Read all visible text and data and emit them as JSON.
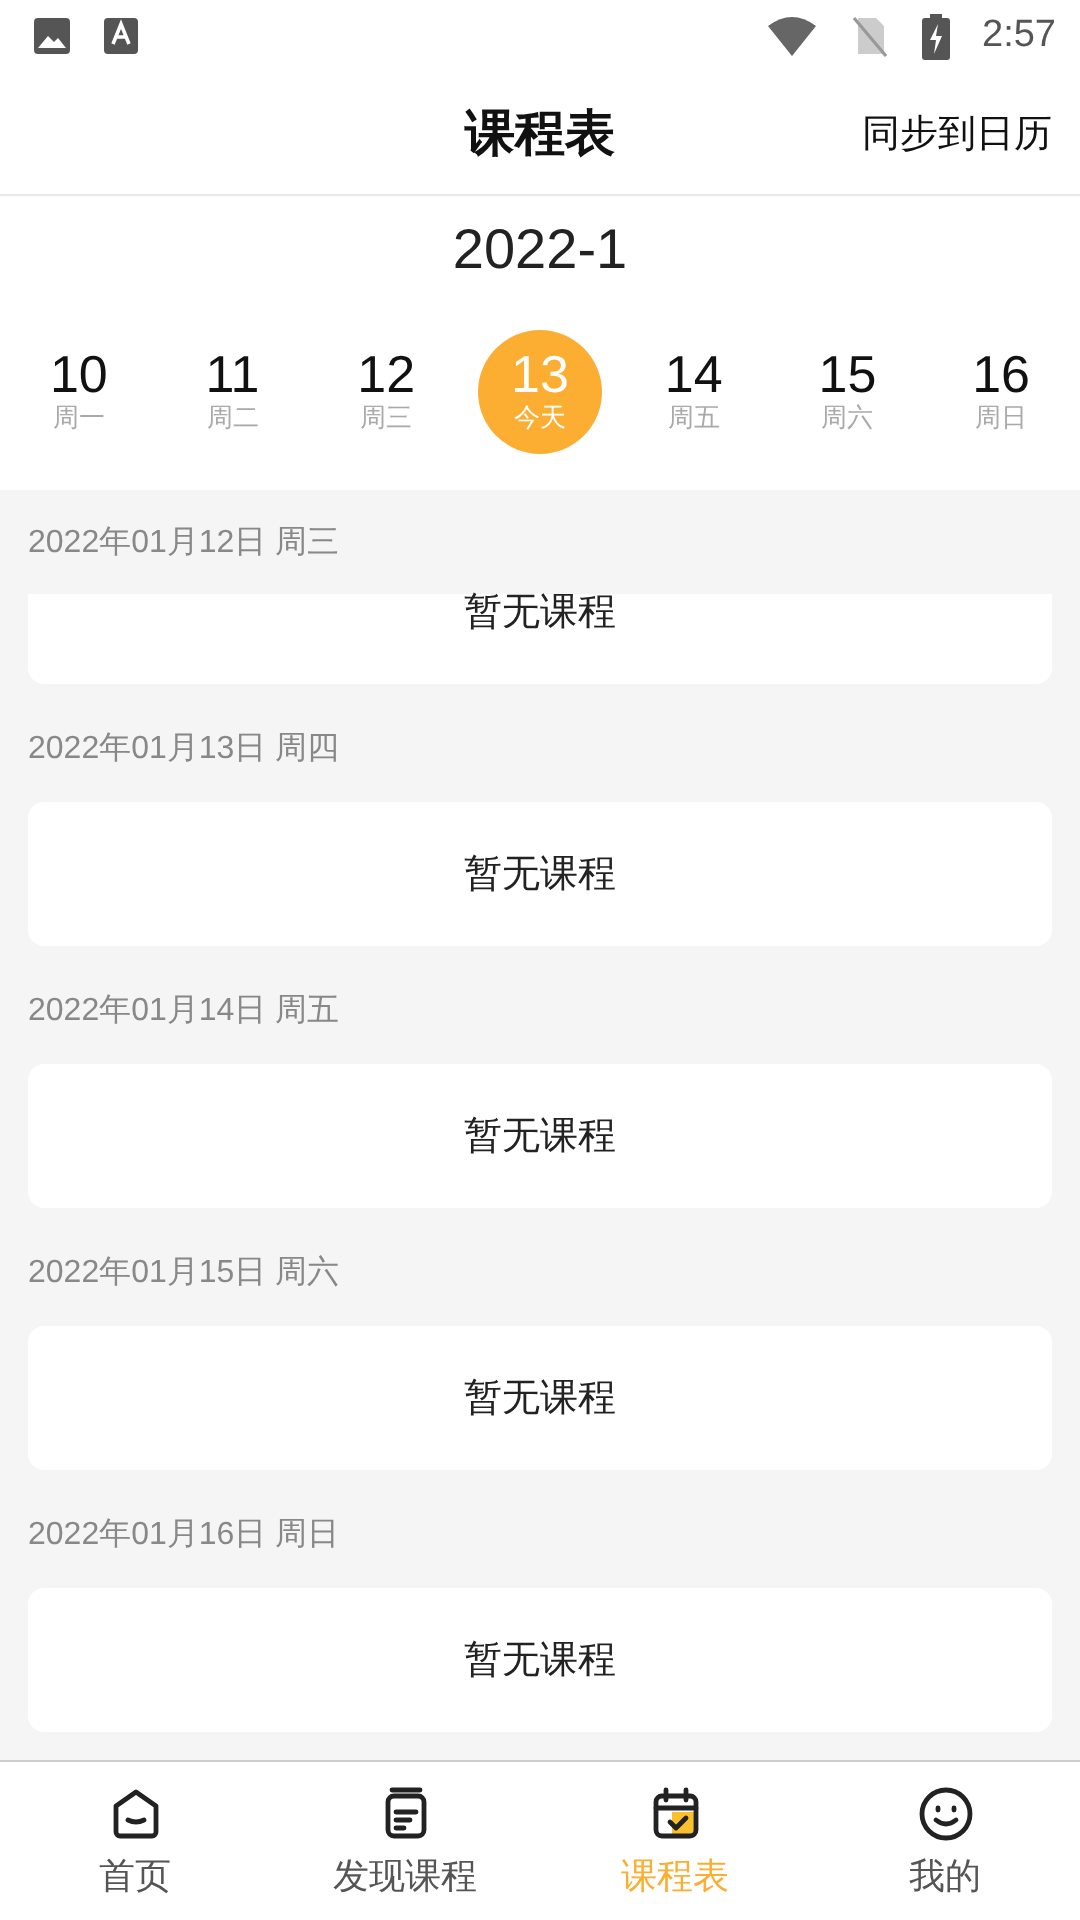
{
  "status_bar": {
    "time": "2:57"
  },
  "header": {
    "title": "课程表",
    "action": "同步到日历"
  },
  "month": "2022-1",
  "week": [
    {
      "day": "10",
      "label": "周一",
      "selected": false
    },
    {
      "day": "11",
      "label": "周二",
      "selected": false
    },
    {
      "day": "12",
      "label": "周三",
      "selected": false
    },
    {
      "day": "13",
      "label": "今天",
      "selected": true
    },
    {
      "day": "14",
      "label": "周五",
      "selected": false
    },
    {
      "day": "15",
      "label": "周六",
      "selected": false
    },
    {
      "day": "16",
      "label": "周日",
      "selected": false
    }
  ],
  "days": [
    {
      "date": "2022年01月12日 周三",
      "message": "暂无课程",
      "cut_off": true
    },
    {
      "date": "2022年01月13日 周四",
      "message": "暂无课程",
      "cut_off": false
    },
    {
      "date": "2022年01月14日 周五",
      "message": "暂无课程",
      "cut_off": false
    },
    {
      "date": "2022年01月15日 周六",
      "message": "暂无课程",
      "cut_off": false
    },
    {
      "date": "2022年01月16日 周日",
      "message": "暂无课程",
      "cut_off": false
    }
  ],
  "nav": [
    {
      "label": "首页",
      "kind": "home",
      "selected": false
    },
    {
      "label": "发现课程",
      "kind": "discover",
      "selected": false
    },
    {
      "label": "课程表",
      "kind": "schedule",
      "selected": true
    },
    {
      "label": "我的",
      "kind": "profile",
      "selected": false
    }
  ]
}
